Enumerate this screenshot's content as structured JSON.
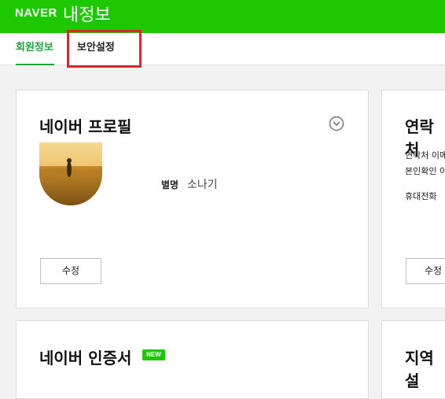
{
  "header": {
    "logo": "NAVER",
    "title": "내정보",
    "brand_color": "#1ec800"
  },
  "tabs": [
    {
      "label": "회원정보",
      "active": true
    },
    {
      "label": "보안설정",
      "active": false,
      "highlighted": true
    }
  ],
  "profile_card": {
    "title": "네이버 프로필",
    "expand_icon": "chevron-down-circle-icon",
    "nickname_label": "별명",
    "nickname_value": "소나기",
    "edit_label": "수정"
  },
  "contact_card": {
    "title": "연락처",
    "line1": "연락처 이메",
    "line2": "본인확인 이",
    "phone_label": "휴대전화",
    "edit_label": "수정"
  },
  "cert_card": {
    "title": "네이버 인증서",
    "badge": "NEW"
  },
  "region_card": {
    "title": "지역 설"
  }
}
